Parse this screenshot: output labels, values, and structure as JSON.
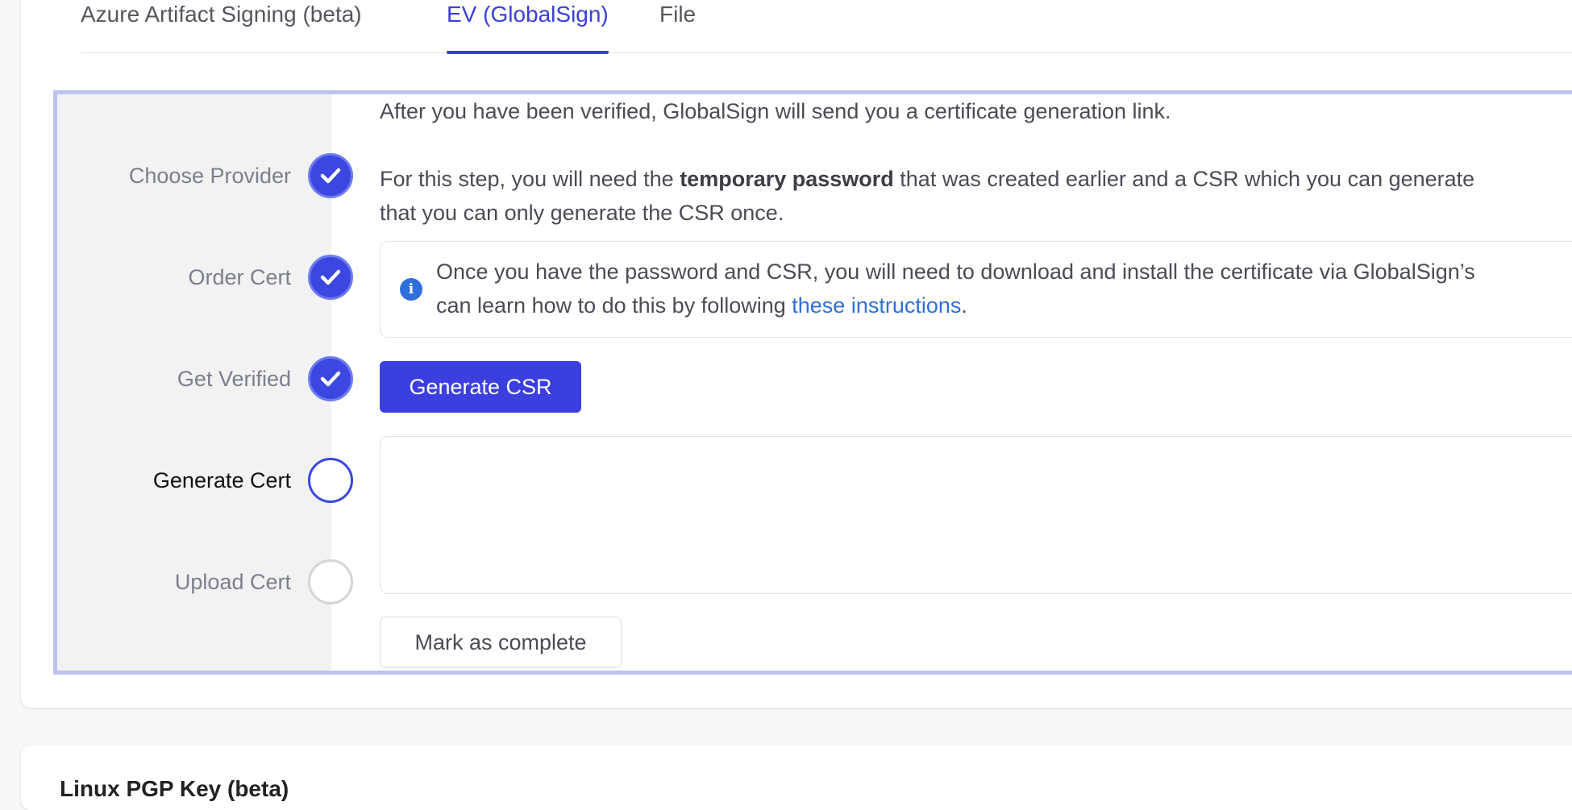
{
  "tabs": [
    {
      "label": "Azure Artifact Signing (beta)",
      "active": false
    },
    {
      "label": "EV (GlobalSign)",
      "active": true
    },
    {
      "label": "File",
      "active": false
    }
  ],
  "steps": [
    {
      "label": "Choose Provider",
      "state": "done"
    },
    {
      "label": "Order Cert",
      "state": "done"
    },
    {
      "label": "Get Verified",
      "state": "done"
    },
    {
      "label": "Generate Cert",
      "state": "current"
    },
    {
      "label": "Upload Cert",
      "state": "todo"
    }
  ],
  "content": {
    "verified_text": "After you have been verified, GlobalSign will send you a certificate generation link.",
    "step_text_before": "For this step, you will need the ",
    "step_text_bold": "temporary password",
    "step_text_after": " that was created earlier and a CSR which you can generate",
    "step_text_line2": "that you can only generate the CSR once.",
    "info_line1": "Once you have the password and CSR, you will need to download and install the certificate via GlobalSign’s",
    "info_line2_before": "can learn how to do this by following ",
    "info_link": "these instructions",
    "info_line2_after": ".",
    "info_icon": "i",
    "generate_button": "Generate CSR",
    "csr_value": "",
    "complete_button": "Mark as complete"
  },
  "next_section_title": "Linux PGP Key (beta)",
  "colors": {
    "accent": "#3b3fe0",
    "link": "#2f6fdc",
    "frame": "#bcc3ef"
  }
}
